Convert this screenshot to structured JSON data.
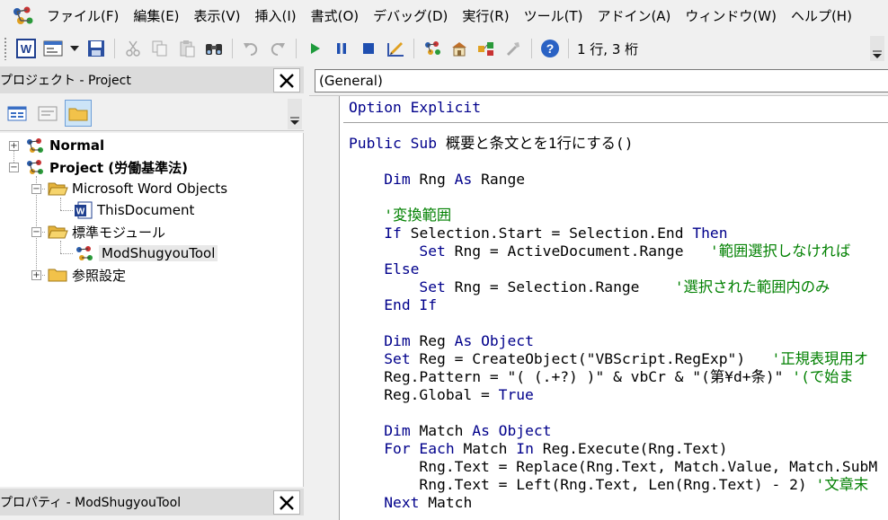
{
  "menu": {
    "items": [
      "ファイル(F)",
      "編集(E)",
      "表示(V)",
      "挿入(I)",
      "書式(O)",
      "デバッグ(D)",
      "実行(R)",
      "ツール(T)",
      "アドイン(A)",
      "ウィンドウ(W)",
      "ヘルプ(H)"
    ]
  },
  "toolbar": {
    "cursor_position": "1 行, 3 桁"
  },
  "project_panel": {
    "title": "プロジェクト - Project",
    "tree": {
      "normal": "Normal",
      "project": "Project (労働基準法)",
      "word_objects": "Microsoft Word Objects",
      "this_document": "ThisDocument",
      "modules": "標準モジュール",
      "module": "ModShugyouTool",
      "references": "参照設定"
    }
  },
  "properties_panel": {
    "title": "プロパティ - ModShugyouTool"
  },
  "code": {
    "object_dropdown": "(General)",
    "lines": [
      [
        [
          "kw",
          "Option Explicit"
        ]
      ],
      [
        [
          "tx",
          ""
        ]
      ],
      [
        [
          "kw",
          "Public Sub "
        ],
        [
          "tx",
          "概要と条文とを1行にする()"
        ]
      ],
      [
        [
          "tx",
          ""
        ]
      ],
      [
        [
          "tx",
          "    "
        ],
        [
          "kw",
          "Dim "
        ],
        [
          "tx",
          "Rng "
        ],
        [
          "kw",
          "As "
        ],
        [
          "tx",
          "Range"
        ]
      ],
      [
        [
          "tx",
          ""
        ]
      ],
      [
        [
          "tx",
          "    "
        ],
        [
          "cm",
          "'変換範囲"
        ]
      ],
      [
        [
          "tx",
          "    "
        ],
        [
          "kw",
          "If "
        ],
        [
          "tx",
          "Selection.Start = Selection.End "
        ],
        [
          "kw",
          "Then"
        ]
      ],
      [
        [
          "tx",
          "        "
        ],
        [
          "kw",
          "Set "
        ],
        [
          "tx",
          "Rng = ActiveDocument.Range   "
        ],
        [
          "cm",
          "'範囲選択しなければ"
        ]
      ],
      [
        [
          "tx",
          "    "
        ],
        [
          "kw",
          "Else"
        ]
      ],
      [
        [
          "tx",
          "        "
        ],
        [
          "kw",
          "Set "
        ],
        [
          "tx",
          "Rng = Selection.Range    "
        ],
        [
          "cm",
          "'選択された範囲内のみ"
        ]
      ],
      [
        [
          "tx",
          "    "
        ],
        [
          "kw",
          "End If"
        ]
      ],
      [
        [
          "tx",
          ""
        ]
      ],
      [
        [
          "tx",
          "    "
        ],
        [
          "kw",
          "Dim "
        ],
        [
          "tx",
          "Reg "
        ],
        [
          "kw",
          "As Object"
        ]
      ],
      [
        [
          "tx",
          "    "
        ],
        [
          "kw",
          "Set "
        ],
        [
          "tx",
          "Reg = CreateObject(\"VBScript.RegExp\")   "
        ],
        [
          "cm",
          "'正規表現用オ"
        ]
      ],
      [
        [
          "tx",
          "    Reg.Pattern = \"( (.+?) )\" & vbCr & \"(第¥d+条)\" "
        ],
        [
          "cm",
          "'(で始ま"
        ]
      ],
      [
        [
          "tx",
          "    Reg.Global = "
        ],
        [
          "kw",
          "True"
        ]
      ],
      [
        [
          "tx",
          ""
        ]
      ],
      [
        [
          "tx",
          "    "
        ],
        [
          "kw",
          "Dim "
        ],
        [
          "tx",
          "Match "
        ],
        [
          "kw",
          "As Object"
        ]
      ],
      [
        [
          "tx",
          "    "
        ],
        [
          "kw",
          "For Each "
        ],
        [
          "tx",
          "Match "
        ],
        [
          "kw",
          "In "
        ],
        [
          "tx",
          "Reg.Execute(Rng.Text)"
        ]
      ],
      [
        [
          "tx",
          "        Rng.Text = Replace(Rng.Text, Match.Value, Match.SubM"
        ]
      ],
      [
        [
          "tx",
          "        Rng.Text = Left(Rng.Text, Len(Rng.Text) - 2) "
        ],
        [
          "cm",
          "'文章末"
        ]
      ],
      [
        [
          "tx",
          "    "
        ],
        [
          "kw",
          "Next "
        ],
        [
          "tx",
          "Match"
        ]
      ]
    ]
  }
}
